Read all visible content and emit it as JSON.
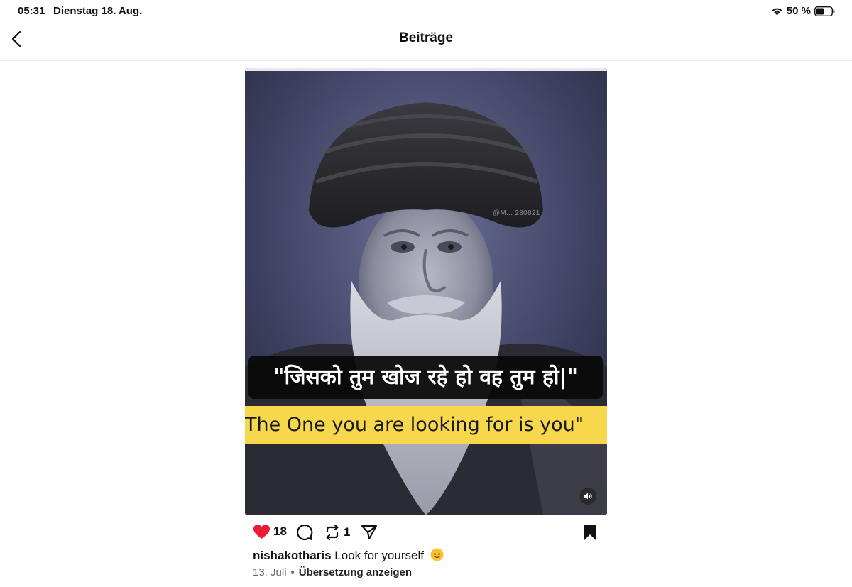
{
  "status_bar": {
    "time": "05:31",
    "date": "Dienstag 18. Aug.",
    "battery_percent": "50 %",
    "battery_level": 0.5,
    "icons": [
      "wifi-icon",
      "battery-icon"
    ]
  },
  "header": {
    "title": "Beiträge",
    "back_icon": "chevron-left-icon"
  },
  "post": {
    "media": {
      "watermark": "@M... 280821",
      "caption_hindi": "\"जिसको तुम खोज रहे हो वह तुम हो|\"",
      "caption_english": "The One you are looking for is you\"",
      "mute_icon": "speaker-icon",
      "colors": {
        "caption_band": "#f7d84c",
        "hindi_band": "#0a0a0a"
      }
    },
    "actions": {
      "likes": "18",
      "reposts": "1",
      "liked": true,
      "like_color": "#ed1c34",
      "icons": [
        "heart-icon",
        "comment-icon",
        "repost-icon",
        "share-icon",
        "bookmark-icon"
      ]
    },
    "caption": {
      "username": "nishakotharis",
      "text": "Look for yourself",
      "emoji": "smiling-face-icon"
    },
    "meta": {
      "date": "13. Juli",
      "separator": "•",
      "translate_label": "Übersetzung anzeigen"
    }
  }
}
